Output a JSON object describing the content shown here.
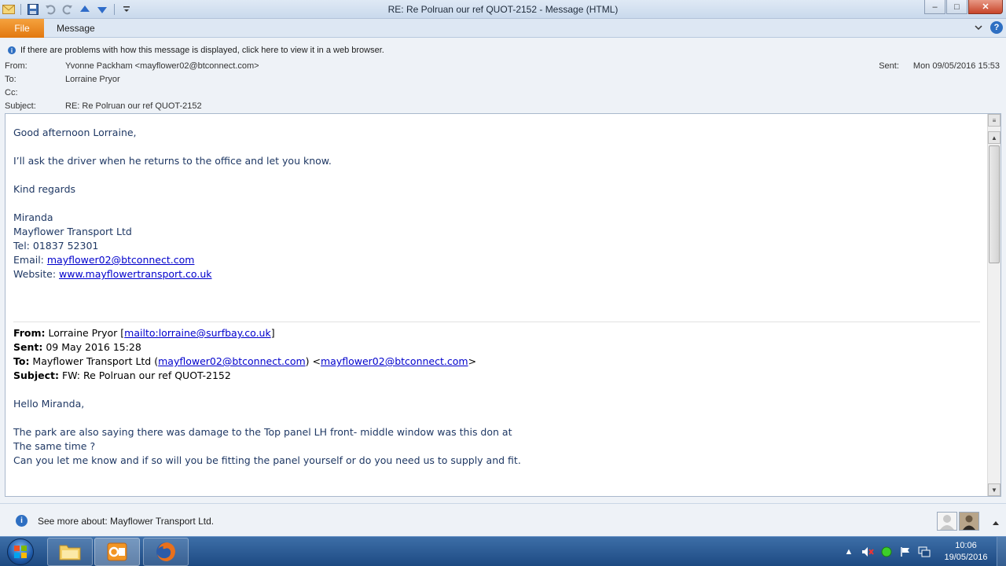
{
  "window": {
    "title": "RE: Re Polruan our ref QUOT-2152  -  Message (HTML)",
    "controls": {
      "minimize": "–",
      "maximize": "□",
      "close": "✕"
    }
  },
  "ribbon": {
    "tabs": [
      {
        "label": "File"
      },
      {
        "label": "Message"
      }
    ]
  },
  "infobar": {
    "text": "If there are problems with how this message is displayed, click here to view it in a web browser."
  },
  "headers": {
    "from_label": "From:",
    "from_value": "Yvonne Packham <mayflower02@btconnect.com>",
    "to_label": "To:",
    "to_value": "Lorraine Pryor",
    "cc_label": "Cc:",
    "cc_value": "",
    "subject_label": "Subject:",
    "subject_value": "RE: Re Polruan our ref QUOT-2152",
    "sent_label": "Sent:",
    "sent_value": "Mon 09/05/2016 15:53"
  },
  "body": {
    "greeting": "Good afternoon Lorraine,",
    "line1": "I’ll ask the driver when he returns to the office and let you know.",
    "regards": "Kind regards",
    "sig_name": "Miranda",
    "sig_company": "Mayflower Transport Ltd",
    "sig_tel": "Tel: 01837 52301",
    "sig_email_label": "Email: ",
    "sig_email": "mayflower02@btconnect.com",
    "sig_web_label": "Website: ",
    "sig_web": "www.mayflowertransport.co.uk",
    "quoted": {
      "from_label": "From:",
      "from_name": " Lorraine Pryor [",
      "from_link": "mailto:lorraine@surfbay.co.uk",
      "from_close": "]",
      "sent_label": "Sent:",
      "sent_value": " 09 May 2016 15:28",
      "to_label": "To:",
      "to_name": " Mayflower Transport Ltd (",
      "to_link1": "mayflower02@btconnect.com",
      "to_mid": ") <",
      "to_link2": "mayflower02@btconnect.com",
      "to_close": ">",
      "subject_label": "Subject:",
      "subject_value": " FW: Re Polruan our ref QUOT-2152",
      "greeting": "Hello Miranda,",
      "para1": "The park are also saying there was damage to the Top panel LH front- middle window was this don at",
      "para2": "The same time ?",
      "para3": "Can you let me know and if so will you be fitting the panel yourself or do you need us to supply and fit."
    }
  },
  "people_pane": {
    "text": "See more about: Mayflower Transport Ltd."
  },
  "taskbar": {
    "apps": [
      {
        "name": "Windows Explorer"
      },
      {
        "name": "Microsoft Outlook"
      },
      {
        "name": "Mozilla Firefox"
      }
    ],
    "clock_time": "10:06",
    "clock_date": "19/05/2016"
  },
  "colors": {
    "body_text": "#1f3864",
    "link": "#0000cc",
    "file_tab": "#e2780f",
    "taskbar": "#1d4a82"
  }
}
